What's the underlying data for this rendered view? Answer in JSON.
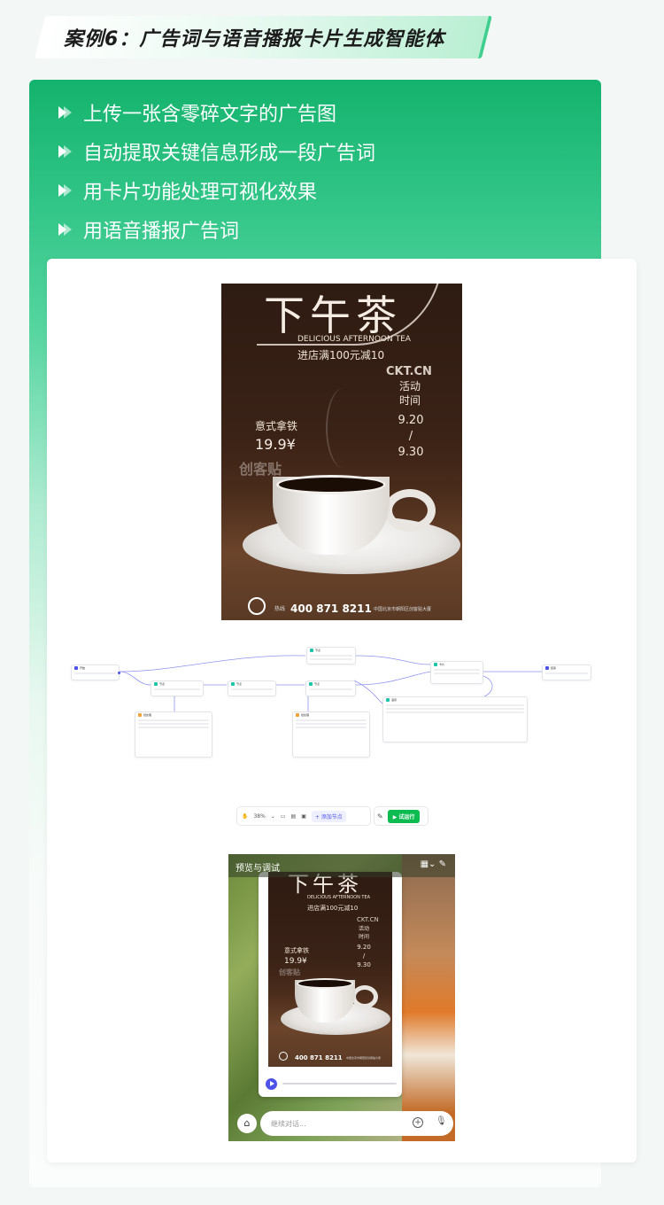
{
  "title": "案例6：广告词与语音播报卡片生成智能体",
  "bullets": [
    "上传一张含零碎文字的广告图",
    "自动提取关键信息形成一段广告词",
    "用卡片功能处理可视化效果",
    "用语音播报广告词"
  ],
  "poster": {
    "title": "下午茶",
    "subtitle_en": "DELICIOUS AFTERNOON TEA",
    "promo": "进店满100元减10",
    "brand": "CKT.CN",
    "activity_label": "活动时间",
    "date_start": "9.20",
    "date_sep": "/",
    "date_end": "9.30",
    "item": "意式拿铁",
    "price": "19.9¥",
    "watermark": "创客贴",
    "phone_label": "热线",
    "phone": "400 871 8211",
    "address": "中国北京市朝阳区创客贴大厦"
  },
  "toolbar": {
    "zoom": "38%",
    "add_node": "+ 添加节点",
    "run": "▶ 试运行"
  },
  "preview": {
    "header": "预览与调试",
    "input_placeholder": "继续对话..."
  },
  "colors": {
    "brand_green": "#14b36d",
    "accent_blue": "#4d53e8",
    "run_green": "#0dbc51"
  }
}
